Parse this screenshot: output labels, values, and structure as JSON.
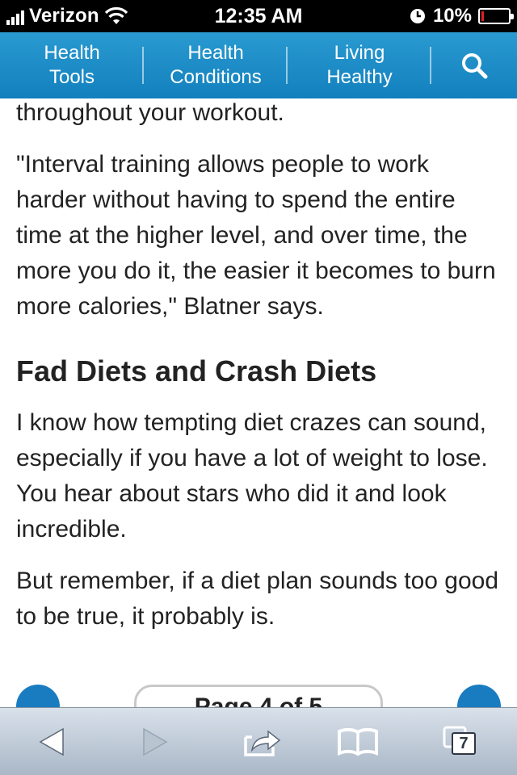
{
  "status_bar": {
    "carrier": "Verizon",
    "time": "12:35 AM",
    "battery_percent": "10%",
    "battery_level": 0.1,
    "icons": [
      "signal-bars-icon",
      "wifi-icon",
      "orientation-lock-icon",
      "battery-icon"
    ]
  },
  "nav": {
    "items": [
      {
        "label": "Health\nTools"
      },
      {
        "label": "Health\nConditions"
      },
      {
        "label": "Living\nHealthy"
      }
    ],
    "search_icon": "search-icon",
    "accent_color": "#1a86c6"
  },
  "article": {
    "paragraphs_before": [
      "throughout your workout.",
      "\"Interval training allows people to work harder without having to spend the entire time at the higher level, and over time, the more you do it, the easier it becomes to burn more calories,\" Blatner says."
    ],
    "heading": "Fad Diets and Crash Diets",
    "paragraphs_after": [
      "I know how tempting diet crazes can sound, especially if you have a lot of weight to lose. You hear about stars who did it and look incredible.",
      "But remember,  if a diet plan sounds too good to be true, it probably is."
    ]
  },
  "pager": {
    "label": "Page 4 of 5"
  },
  "toolbar": {
    "tabs_count": "7",
    "icons": [
      "back-arrow-icon",
      "forward-arrow-icon",
      "share-icon",
      "bookmarks-icon",
      "tabs-icon"
    ]
  }
}
